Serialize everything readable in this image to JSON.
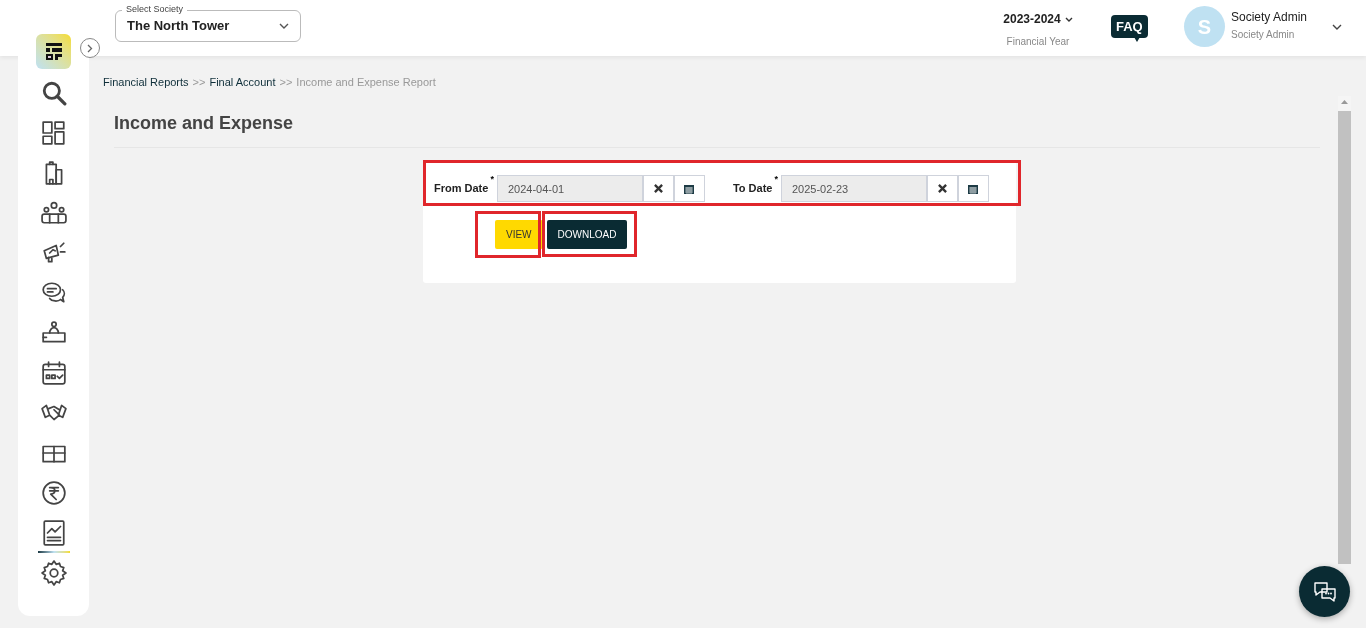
{
  "header": {
    "society_select": {
      "label": "Select Society",
      "value": "The North Tower"
    },
    "financial_year": {
      "value": "2023-2024",
      "label": "Financial Year"
    },
    "faq": "FAQ",
    "user": {
      "avatar": "S",
      "name": "Society Admin",
      "role": "Society Admin"
    }
  },
  "sidebar": {
    "items": [
      {
        "kind": "search",
        "selected": false
      },
      {
        "kind": "dashboard",
        "selected": false
      },
      {
        "kind": "building",
        "selected": false
      },
      {
        "kind": "members",
        "selected": false
      },
      {
        "kind": "announce",
        "selected": false
      },
      {
        "kind": "chat",
        "selected": false
      },
      {
        "kind": "desk",
        "selected": false
      },
      {
        "kind": "calendar",
        "selected": false
      },
      {
        "kind": "handshake",
        "selected": false
      },
      {
        "kind": "box",
        "selected": false
      },
      {
        "kind": "rupee",
        "selected": false
      },
      {
        "kind": "report",
        "selected": true
      },
      {
        "kind": "settings",
        "selected": false
      }
    ]
  },
  "breadcrumb": [
    {
      "label": "Financial Reports",
      "current": false
    },
    {
      "label": "Final Account",
      "current": false
    },
    {
      "label": "Income and Expense Report",
      "current": true
    }
  ],
  "breadcrumb_separator": ">>",
  "page_title": "Income and Expense",
  "form": {
    "from_date": {
      "label": "From Date",
      "required_mark": "*",
      "value": "2024-04-01"
    },
    "to_date": {
      "label": "To Date",
      "required_mark": "*",
      "value": "2025-02-23"
    },
    "buttons": [
      {
        "label": "VIEW",
        "kind": "primary"
      },
      {
        "label": "DOWNLOAD",
        "kind": "dark"
      }
    ]
  }
}
